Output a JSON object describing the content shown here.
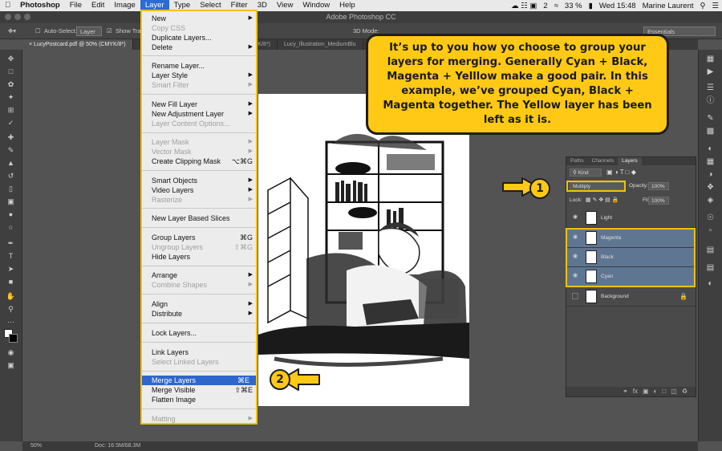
{
  "menubar": {
    "apple": "",
    "items": [
      "Photoshop",
      "File",
      "Edit",
      "Image",
      "Layer",
      "Type",
      "Select",
      "Filter",
      "3D",
      "View",
      "Window",
      "Help"
    ],
    "right": {
      "battery": "33 %",
      "clock": "Wed 15:48",
      "user": "Marine Laurent",
      "badge": "2"
    }
  },
  "window": {
    "title": "Adobe Photoshop CC"
  },
  "options_bar": {
    "auto_select": "Auto-Select:",
    "auto_select_value": "Layer",
    "show_transform": "Show Tran",
    "mode_3d": "3D Mode:",
    "workspace": "Essentials"
  },
  "tabs": [
    "LucyPostcard.pdf @ 50% (CMYK/8*)",
    "×",
    "(CMYK/8*)",
    "Lucy_Illustration_MediumBlu"
  ],
  "status": {
    "zoom": "50%",
    "doc": "Doc: 16.5M/68.3M"
  },
  "layer_menu": {
    "items": [
      {
        "label": "New",
        "arrow": "▶"
      },
      {
        "label": "Copy CSS",
        "disabled": true
      },
      {
        "label": "Duplicate Layers..."
      },
      {
        "label": "Delete",
        "arrow": "▶"
      },
      {
        "label": "Rename Layer..."
      },
      {
        "label": "Layer Style",
        "arrow": "▶"
      },
      {
        "label": "Smart Filter",
        "arrow": "▶",
        "disabled": true
      },
      {
        "label": "New Fill Layer",
        "arrow": "▶"
      },
      {
        "label": "New Adjustment Layer",
        "arrow": "▶"
      },
      {
        "label": "Layer Content Options...",
        "disabled": true
      },
      {
        "label": "Layer Mask",
        "arrow": "▶",
        "disabled": true
      },
      {
        "label": "Vector Mask",
        "arrow": "▶",
        "disabled": true
      },
      {
        "label": "Create Clipping Mask",
        "shortcut": "⌥⌘G"
      },
      {
        "label": "Smart Objects",
        "arrow": "▶"
      },
      {
        "label": "Video Layers",
        "arrow": "▶"
      },
      {
        "label": "Rasterize",
        "arrow": "▶",
        "disabled": true
      },
      {
        "label": "New Layer Based Slices"
      },
      {
        "label": "Group Layers",
        "shortcut": "⌘G"
      },
      {
        "label": "Ungroup Layers",
        "shortcut": "⇧⌘G",
        "disabled": true
      },
      {
        "label": "Hide Layers"
      },
      {
        "label": "Arrange",
        "arrow": "▶"
      },
      {
        "label": "Combine Shapes",
        "arrow": "▶",
        "disabled": true
      },
      {
        "label": "Align",
        "arrow": "▶"
      },
      {
        "label": "Distribute",
        "arrow": "▶"
      },
      {
        "label": "Lock Layers..."
      },
      {
        "label": "Link Layers"
      },
      {
        "label": "Select Linked Layers",
        "disabled": true
      },
      {
        "label": "Merge Layers",
        "shortcut": "⌘E",
        "highlighted": true
      },
      {
        "label": "Merge Visible",
        "shortcut": "⇧⌘E"
      },
      {
        "label": "Flatten Image"
      },
      {
        "label": "Matting",
        "arrow": "▶",
        "disabled": true
      }
    ]
  },
  "callout": {
    "text": "It’s up to you how yo choose to group your layers for merging. Generally Cyan + Black, Magenta + Yelllow make a good pair. In this example, we’ve grouped Cyan, Black + Magenta together. The Yellow layer has been left as it is."
  },
  "badges": {
    "one": "1",
    "two": "2"
  },
  "layers_panel": {
    "tabs": [
      "Paths",
      "Channels",
      "Layers"
    ],
    "filter": "Kind",
    "blend_mode": "Multiply",
    "opacity_label": "Opacity:",
    "opacity_value": "100%",
    "lock_label": "Lock:",
    "fill_label": "Fill:",
    "fill_value": "100%",
    "layers": [
      {
        "name": "Light",
        "selected": false
      },
      {
        "name": "Magenta",
        "selected": true
      },
      {
        "name": "Black",
        "selected": true
      },
      {
        "name": "Cyan",
        "selected": true
      },
      {
        "name": "Background",
        "selected": false
      }
    ]
  },
  "colors": {
    "accent": "#ffc915",
    "menu_highlight": "#2f66cc",
    "layer_selected": "#5f7692"
  }
}
